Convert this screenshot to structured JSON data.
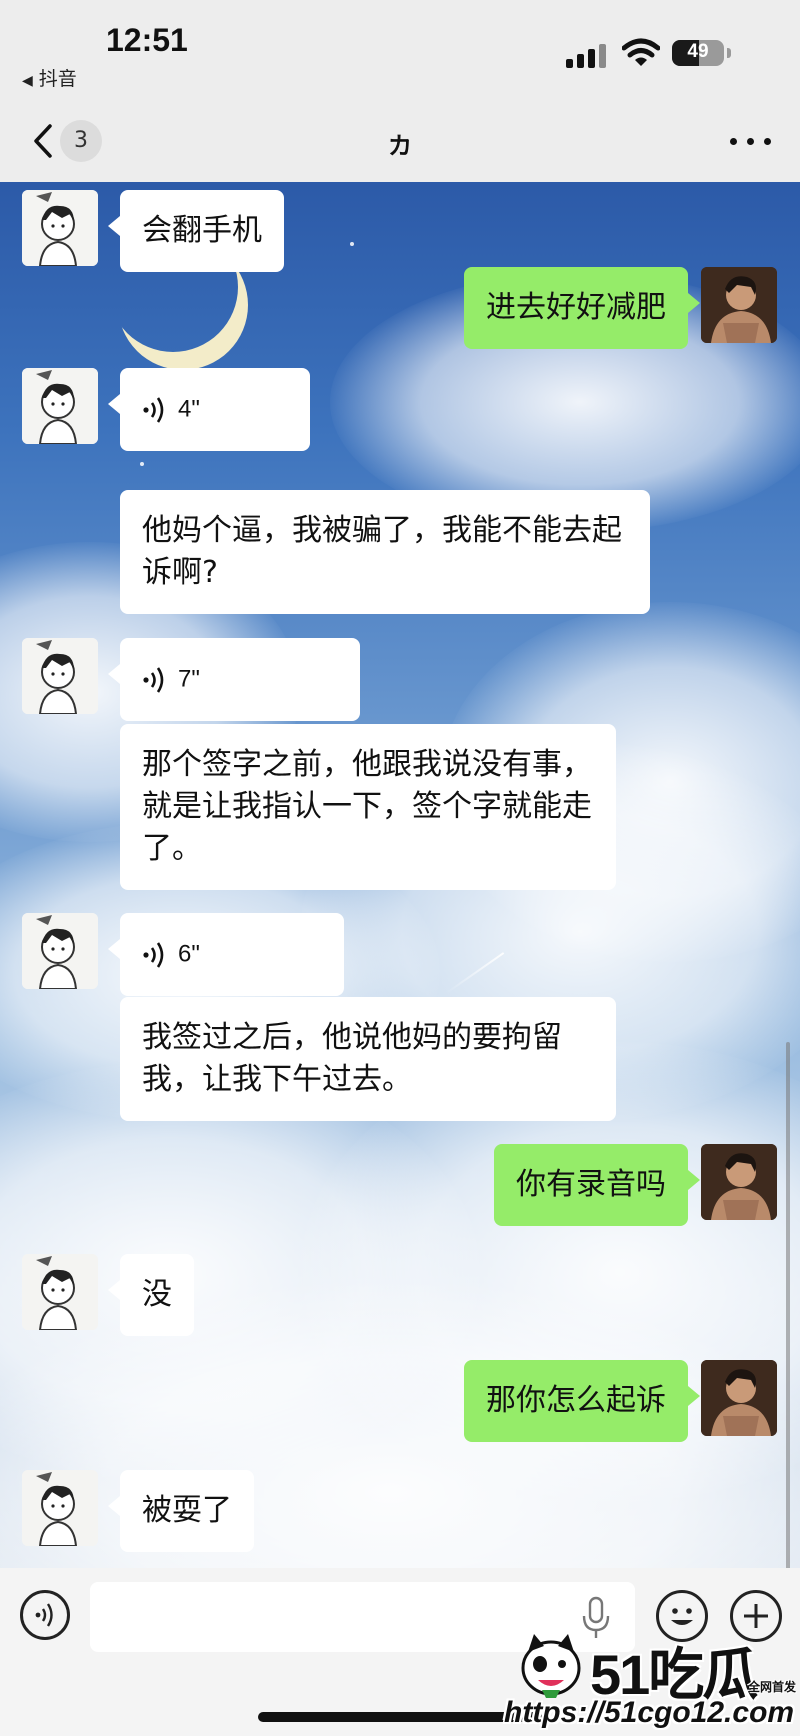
{
  "status_bar": {
    "time": "12:51",
    "back_app_label": "抖音",
    "battery_level": "49"
  },
  "header": {
    "unread_count": "3",
    "title": "カ"
  },
  "messages": [
    {
      "sender": "other",
      "type": "text",
      "text": "会翻手机"
    },
    {
      "sender": "me",
      "type": "text",
      "text": "进去好好减肥"
    },
    {
      "sender": "other",
      "type": "voice",
      "duration": "4\""
    },
    {
      "sender": "other",
      "type": "text",
      "text": "他妈个逼，我被骗了，我能不能去起诉啊?"
    },
    {
      "sender": "other",
      "type": "voice",
      "duration": "7\""
    },
    {
      "sender": "other",
      "type": "text",
      "text": "那个签字之前，他跟我说没有事，就是让我指认一下，签个字就能走了。"
    },
    {
      "sender": "other",
      "type": "voice",
      "duration": "6\""
    },
    {
      "sender": "other",
      "type": "text",
      "text": "我签过之后，他说他妈的要拘留我，让我下午过去。"
    },
    {
      "sender": "me",
      "type": "text",
      "text": "你有录音吗"
    },
    {
      "sender": "other",
      "type": "text",
      "text": "没"
    },
    {
      "sender": "me",
      "type": "text",
      "text": "那你怎么起诉"
    },
    {
      "sender": "other",
      "type": "text",
      "text": "被耍了"
    }
  ],
  "input_bar": {
    "placeholder": ""
  },
  "watermark": {
    "brand": "51吃瓜",
    "tag": "全网首发",
    "url": "https://51cgo12.com"
  },
  "colors": {
    "my_bubble": "#95ec69",
    "other_bubble": "#ffffff",
    "bar_background": "#ededed"
  },
  "icons": {
    "back": "chevron-left-icon",
    "more": "more-dots-icon",
    "voice_message": "voice-wave-icon",
    "voice_input": "voice-input-icon",
    "mic": "mic-icon",
    "emoji": "emoji-icon",
    "plus": "plus-icon"
  }
}
